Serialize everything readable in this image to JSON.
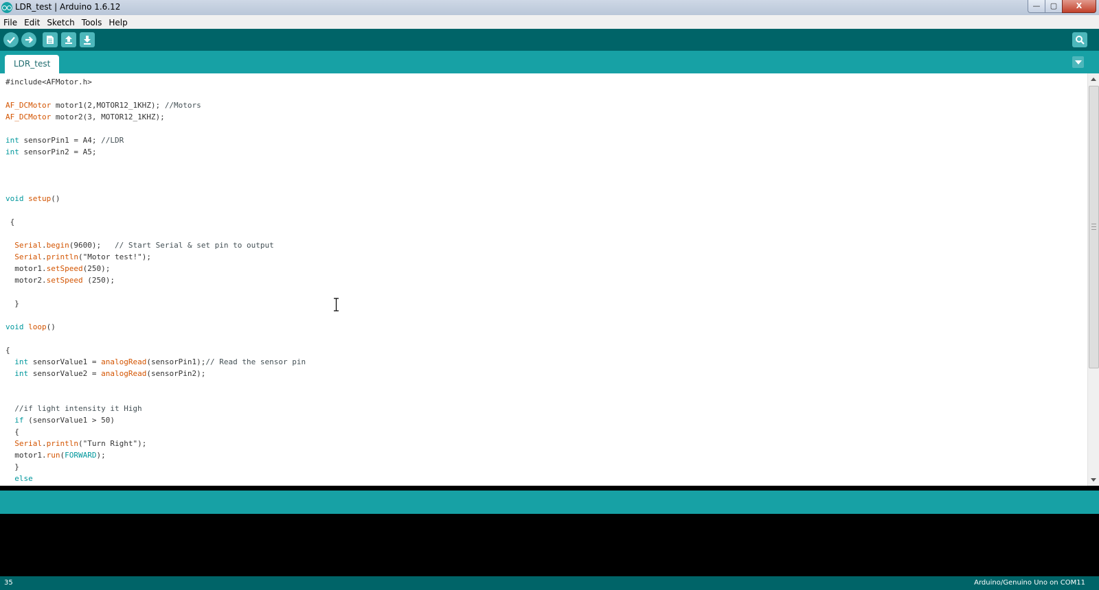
{
  "window": {
    "title": "LDR_test | Arduino 1.6.12",
    "controls": {
      "minimize": "—",
      "maximize": "▢",
      "close": "X"
    }
  },
  "menu": [
    "File",
    "Edit",
    "Sketch",
    "Tools",
    "Help"
  ],
  "toolbar": {
    "buttons": [
      "verify-icon",
      "upload-icon",
      "new-icon",
      "open-icon",
      "save-icon"
    ],
    "serial_monitor": "magnifier-icon",
    "bg_color": "#006468",
    "button_color": "#4db7bb"
  },
  "tabs": [
    {
      "label": "LDR_test",
      "active": true
    }
  ],
  "colors": {
    "accent": "#17a1a5",
    "keyword": "#00979c",
    "function": "#d35400",
    "class": "#d35400",
    "comment": "#434f54",
    "text": "#333333"
  },
  "code": [
    [
      {
        "t": "#include<AFMotor.h>",
        "c": "text"
      }
    ],
    [],
    [
      {
        "t": "AF_DCMotor",
        "c": "cls"
      },
      {
        "t": " motor1(2,MOTOR12_1KHZ); ",
        "c": "text"
      },
      {
        "t": "//Motors",
        "c": "cmt"
      }
    ],
    [
      {
        "t": "AF_DCMotor",
        "c": "cls"
      },
      {
        "t": " motor2(3, MOTOR12_1KHZ);",
        "c": "text"
      }
    ],
    [],
    [
      {
        "t": "int",
        "c": "kw"
      },
      {
        "t": " sensorPin1 = A4; ",
        "c": "text"
      },
      {
        "t": "//LDR",
        "c": "cmt"
      }
    ],
    [
      {
        "t": "int",
        "c": "kw"
      },
      {
        "t": " sensorPin2 = A5;",
        "c": "text"
      }
    ],
    [],
    [],
    [],
    [
      {
        "t": "void",
        "c": "kw"
      },
      {
        "t": " ",
        "c": "text"
      },
      {
        "t": "setup",
        "c": "fn"
      },
      {
        "t": "()",
        "c": "text"
      }
    ],
    [],
    [
      {
        "t": " {",
        "c": "text"
      }
    ],
    [],
    [
      {
        "t": "  ",
        "c": "text"
      },
      {
        "t": "Serial",
        "c": "cls"
      },
      {
        "t": ".",
        "c": "text"
      },
      {
        "t": "begin",
        "c": "fn"
      },
      {
        "t": "(9600);   ",
        "c": "text"
      },
      {
        "t": "// Start Serial & set pin to output",
        "c": "cmt"
      }
    ],
    [
      {
        "t": "  ",
        "c": "text"
      },
      {
        "t": "Serial",
        "c": "cls"
      },
      {
        "t": ".",
        "c": "text"
      },
      {
        "t": "println",
        "c": "fn"
      },
      {
        "t": "(\"Motor test!\");",
        "c": "text"
      }
    ],
    [
      {
        "t": "  motor1.",
        "c": "text"
      },
      {
        "t": "setSpeed",
        "c": "fn"
      },
      {
        "t": "(250);",
        "c": "text"
      }
    ],
    [
      {
        "t": "  motor2.",
        "c": "text"
      },
      {
        "t": "setSpeed",
        "c": "fn"
      },
      {
        "t": " (250);",
        "c": "text"
      }
    ],
    [],
    [
      {
        "t": "  }",
        "c": "text"
      }
    ],
    [],
    [
      {
        "t": "void",
        "c": "kw"
      },
      {
        "t": " ",
        "c": "text"
      },
      {
        "t": "loop",
        "c": "fn"
      },
      {
        "t": "()",
        "c": "text"
      }
    ],
    [],
    [
      {
        "t": "{",
        "c": "text"
      }
    ],
    [
      {
        "t": "  ",
        "c": "text"
      },
      {
        "t": "int",
        "c": "kw"
      },
      {
        "t": " sensorValue1 = ",
        "c": "text"
      },
      {
        "t": "analogRead",
        "c": "fn"
      },
      {
        "t": "(sensorPin1);",
        "c": "text"
      },
      {
        "t": "// Read the sensor pin",
        "c": "cmt"
      }
    ],
    [
      {
        "t": "  ",
        "c": "text"
      },
      {
        "t": "int",
        "c": "kw"
      },
      {
        "t": " sensorValue2 = ",
        "c": "text"
      },
      {
        "t": "analogRead",
        "c": "fn"
      },
      {
        "t": "(sensorPin2);",
        "c": "text"
      }
    ],
    [],
    [],
    [
      {
        "t": "  ",
        "c": "text"
      },
      {
        "t": "//if light intensity it High",
        "c": "cmt"
      }
    ],
    [
      {
        "t": "  ",
        "c": "text"
      },
      {
        "t": "if",
        "c": "kw"
      },
      {
        "t": " (sensorValue1 > 50)",
        "c": "text"
      }
    ],
    [
      {
        "t": "  {",
        "c": "text"
      }
    ],
    [
      {
        "t": "  ",
        "c": "text"
      },
      {
        "t": "Serial",
        "c": "cls"
      },
      {
        "t": ".",
        "c": "text"
      },
      {
        "t": "println",
        "c": "fn"
      },
      {
        "t": "(\"Turn Right\");",
        "c": "text"
      }
    ],
    [
      {
        "t": "  motor1.",
        "c": "text"
      },
      {
        "t": "run",
        "c": "fn"
      },
      {
        "t": "(",
        "c": "text"
      },
      {
        "t": "FORWARD",
        "c": "kw"
      },
      {
        "t": ");",
        "c": "text"
      }
    ],
    [
      {
        "t": "  }",
        "c": "text"
      }
    ],
    [
      {
        "t": "  ",
        "c": "text"
      },
      {
        "t": "else",
        "c": "kw"
      }
    ],
    [
      {
        "t": "  {",
        "c": "text"
      }
    ]
  ],
  "status": {
    "line_number": "35",
    "board": "Arduino/Genuino Uno on COM11"
  }
}
